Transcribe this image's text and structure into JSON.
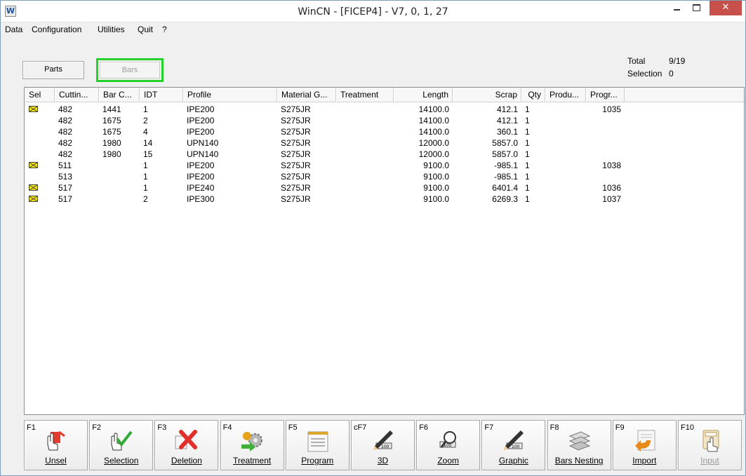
{
  "window": {
    "app_icon": "W",
    "title": "WinCN - [FICEP4] - V7, 0, 1, 27",
    "close_glyph": "✕"
  },
  "menu": [
    "Data",
    "Configuration",
    "Utilities",
    "Quit",
    "?"
  ],
  "tabs": {
    "parts": "Parts",
    "bars": "Bars"
  },
  "summary": {
    "total_label": "Total",
    "total_value": "9/19",
    "selection_label": "Selection",
    "selection_value": "0"
  },
  "table": {
    "columns": [
      "Sel",
      "Cuttin...",
      "Bar C...",
      "IDT",
      "Profile",
      "Material G...",
      "Treatment",
      "Length",
      "Scrap",
      "Qty",
      "Produ...",
      "Progr..."
    ],
    "rows": [
      {
        "sel": true,
        "cutting": "482",
        "bar": "1441",
        "idt": "1",
        "profile": "IPE200",
        "material": "S275JR",
        "treatment": "",
        "length": "14100.0",
        "scrap": "412.1",
        "qty": "1",
        "produ": "",
        "progr": "1035"
      },
      {
        "sel": false,
        "cutting": "482",
        "bar": "1675",
        "idt": "2",
        "profile": "IPE200",
        "material": "S275JR",
        "treatment": "",
        "length": "14100.0",
        "scrap": "412.1",
        "qty": "1",
        "produ": "",
        "progr": ""
      },
      {
        "sel": false,
        "cutting": "482",
        "bar": "1675",
        "idt": "4",
        "profile": "IPE200",
        "material": "S275JR",
        "treatment": "",
        "length": "14100.0",
        "scrap": "360.1",
        "qty": "1",
        "produ": "",
        "progr": ""
      },
      {
        "sel": false,
        "cutting": "482",
        "bar": "1980",
        "idt": "14",
        "profile": "UPN140",
        "material": "S275JR",
        "treatment": "",
        "length": "12000.0",
        "scrap": "5857.0",
        "qty": "1",
        "produ": "",
        "progr": ""
      },
      {
        "sel": false,
        "cutting": "482",
        "bar": "1980",
        "idt": "15",
        "profile": "UPN140",
        "material": "S275JR",
        "treatment": "",
        "length": "12000.0",
        "scrap": "5857.0",
        "qty": "1",
        "produ": "",
        "progr": ""
      },
      {
        "sel": true,
        "cutting": "511",
        "bar": "",
        "idt": "1",
        "profile": "IPE200",
        "material": "S275JR",
        "treatment": "",
        "length": "9100.0",
        "scrap": "-985.1",
        "qty": "1",
        "produ": "",
        "progr": "1038"
      },
      {
        "sel": false,
        "cutting": "513",
        "bar": "",
        "idt": "1",
        "profile": "IPE200",
        "material": "S275JR",
        "treatment": "",
        "length": "9100.0",
        "scrap": "-985.1",
        "qty": "1",
        "produ": "",
        "progr": ""
      },
      {
        "sel": true,
        "cutting": "517",
        "bar": "",
        "idt": "1",
        "profile": "IPE240",
        "material": "S275JR",
        "treatment": "",
        "length": "9100.0",
        "scrap": "6401.4",
        "qty": "1",
        "produ": "",
        "progr": "1036"
      },
      {
        "sel": true,
        "cutting": "517",
        "bar": "",
        "idt": "2",
        "profile": "IPE300",
        "material": "S275JR",
        "treatment": "",
        "length": "9100.0",
        "scrap": "6269.3",
        "qty": "1",
        "produ": "",
        "progr": "1037"
      }
    ]
  },
  "toolbar": [
    {
      "key": "F1",
      "label": "Unsel",
      "icon": "unselect-icon",
      "enabled": true
    },
    {
      "key": "F2",
      "label": "Selection",
      "icon": "selection-check-icon",
      "enabled": true
    },
    {
      "key": "F3",
      "label": "Deletion",
      "icon": "delete-x-icon",
      "enabled": true
    },
    {
      "key": "F4",
      "label": "Treatment",
      "icon": "gears-icon",
      "enabled": true
    },
    {
      "key": "F5",
      "label": "Program",
      "icon": "notepad-icon",
      "enabled": true
    },
    {
      "key": "cF7",
      "label": "3D",
      "icon": "pencil-ruler-icon",
      "enabled": true
    },
    {
      "key": "F6",
      "label": "Zoom",
      "icon": "magnifier-icon",
      "enabled": true
    },
    {
      "key": "F7",
      "label": "Graphic",
      "icon": "pencil-ruler-icon",
      "enabled": true
    },
    {
      "key": "F8",
      "label": "Bars Nesting",
      "icon": "stacked-bars-icon",
      "enabled": true
    },
    {
      "key": "F9",
      "label": "Import",
      "icon": "import-arrow-icon",
      "enabled": true
    },
    {
      "key": "F10",
      "label": "Input",
      "icon": "calculator-hand-icon",
      "enabled": false
    }
  ]
}
